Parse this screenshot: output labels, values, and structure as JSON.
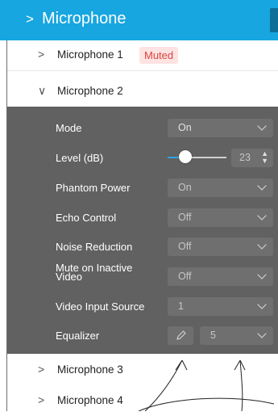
{
  "header": {
    "chevron": ">",
    "title": "Microphone"
  },
  "devices": [
    {
      "chevron": ">",
      "label": "Microphone 1",
      "badge": "Muted"
    },
    {
      "chevron": "∨",
      "label": "Microphone 2"
    },
    {
      "chevron": ">",
      "label": "Microphone 3"
    },
    {
      "chevron": ">",
      "label": "Microphone 4"
    }
  ],
  "settings": {
    "mode": {
      "label": "Mode",
      "value": "On"
    },
    "level": {
      "label": "Level (dB)",
      "value": "23",
      "fraction": 0.3
    },
    "phantom": {
      "label": "Phantom Power",
      "value": "On"
    },
    "echo": {
      "label": "Echo Control",
      "value": "Off"
    },
    "noise": {
      "label": "Noise Reduction",
      "value": "Off"
    },
    "mute_inactive": {
      "label_line1": "Mute on Inactive",
      "label_line2": "Video",
      "value": "Off"
    },
    "video_input": {
      "label": "Video Input Source",
      "value": "1"
    },
    "equalizer": {
      "label": "Equalizer",
      "value": "5"
    }
  },
  "colors": {
    "accent": "#17a6e0",
    "panel": "#616161",
    "badge_bg": "#fde3e2",
    "badge_text": "#d9453f"
  }
}
